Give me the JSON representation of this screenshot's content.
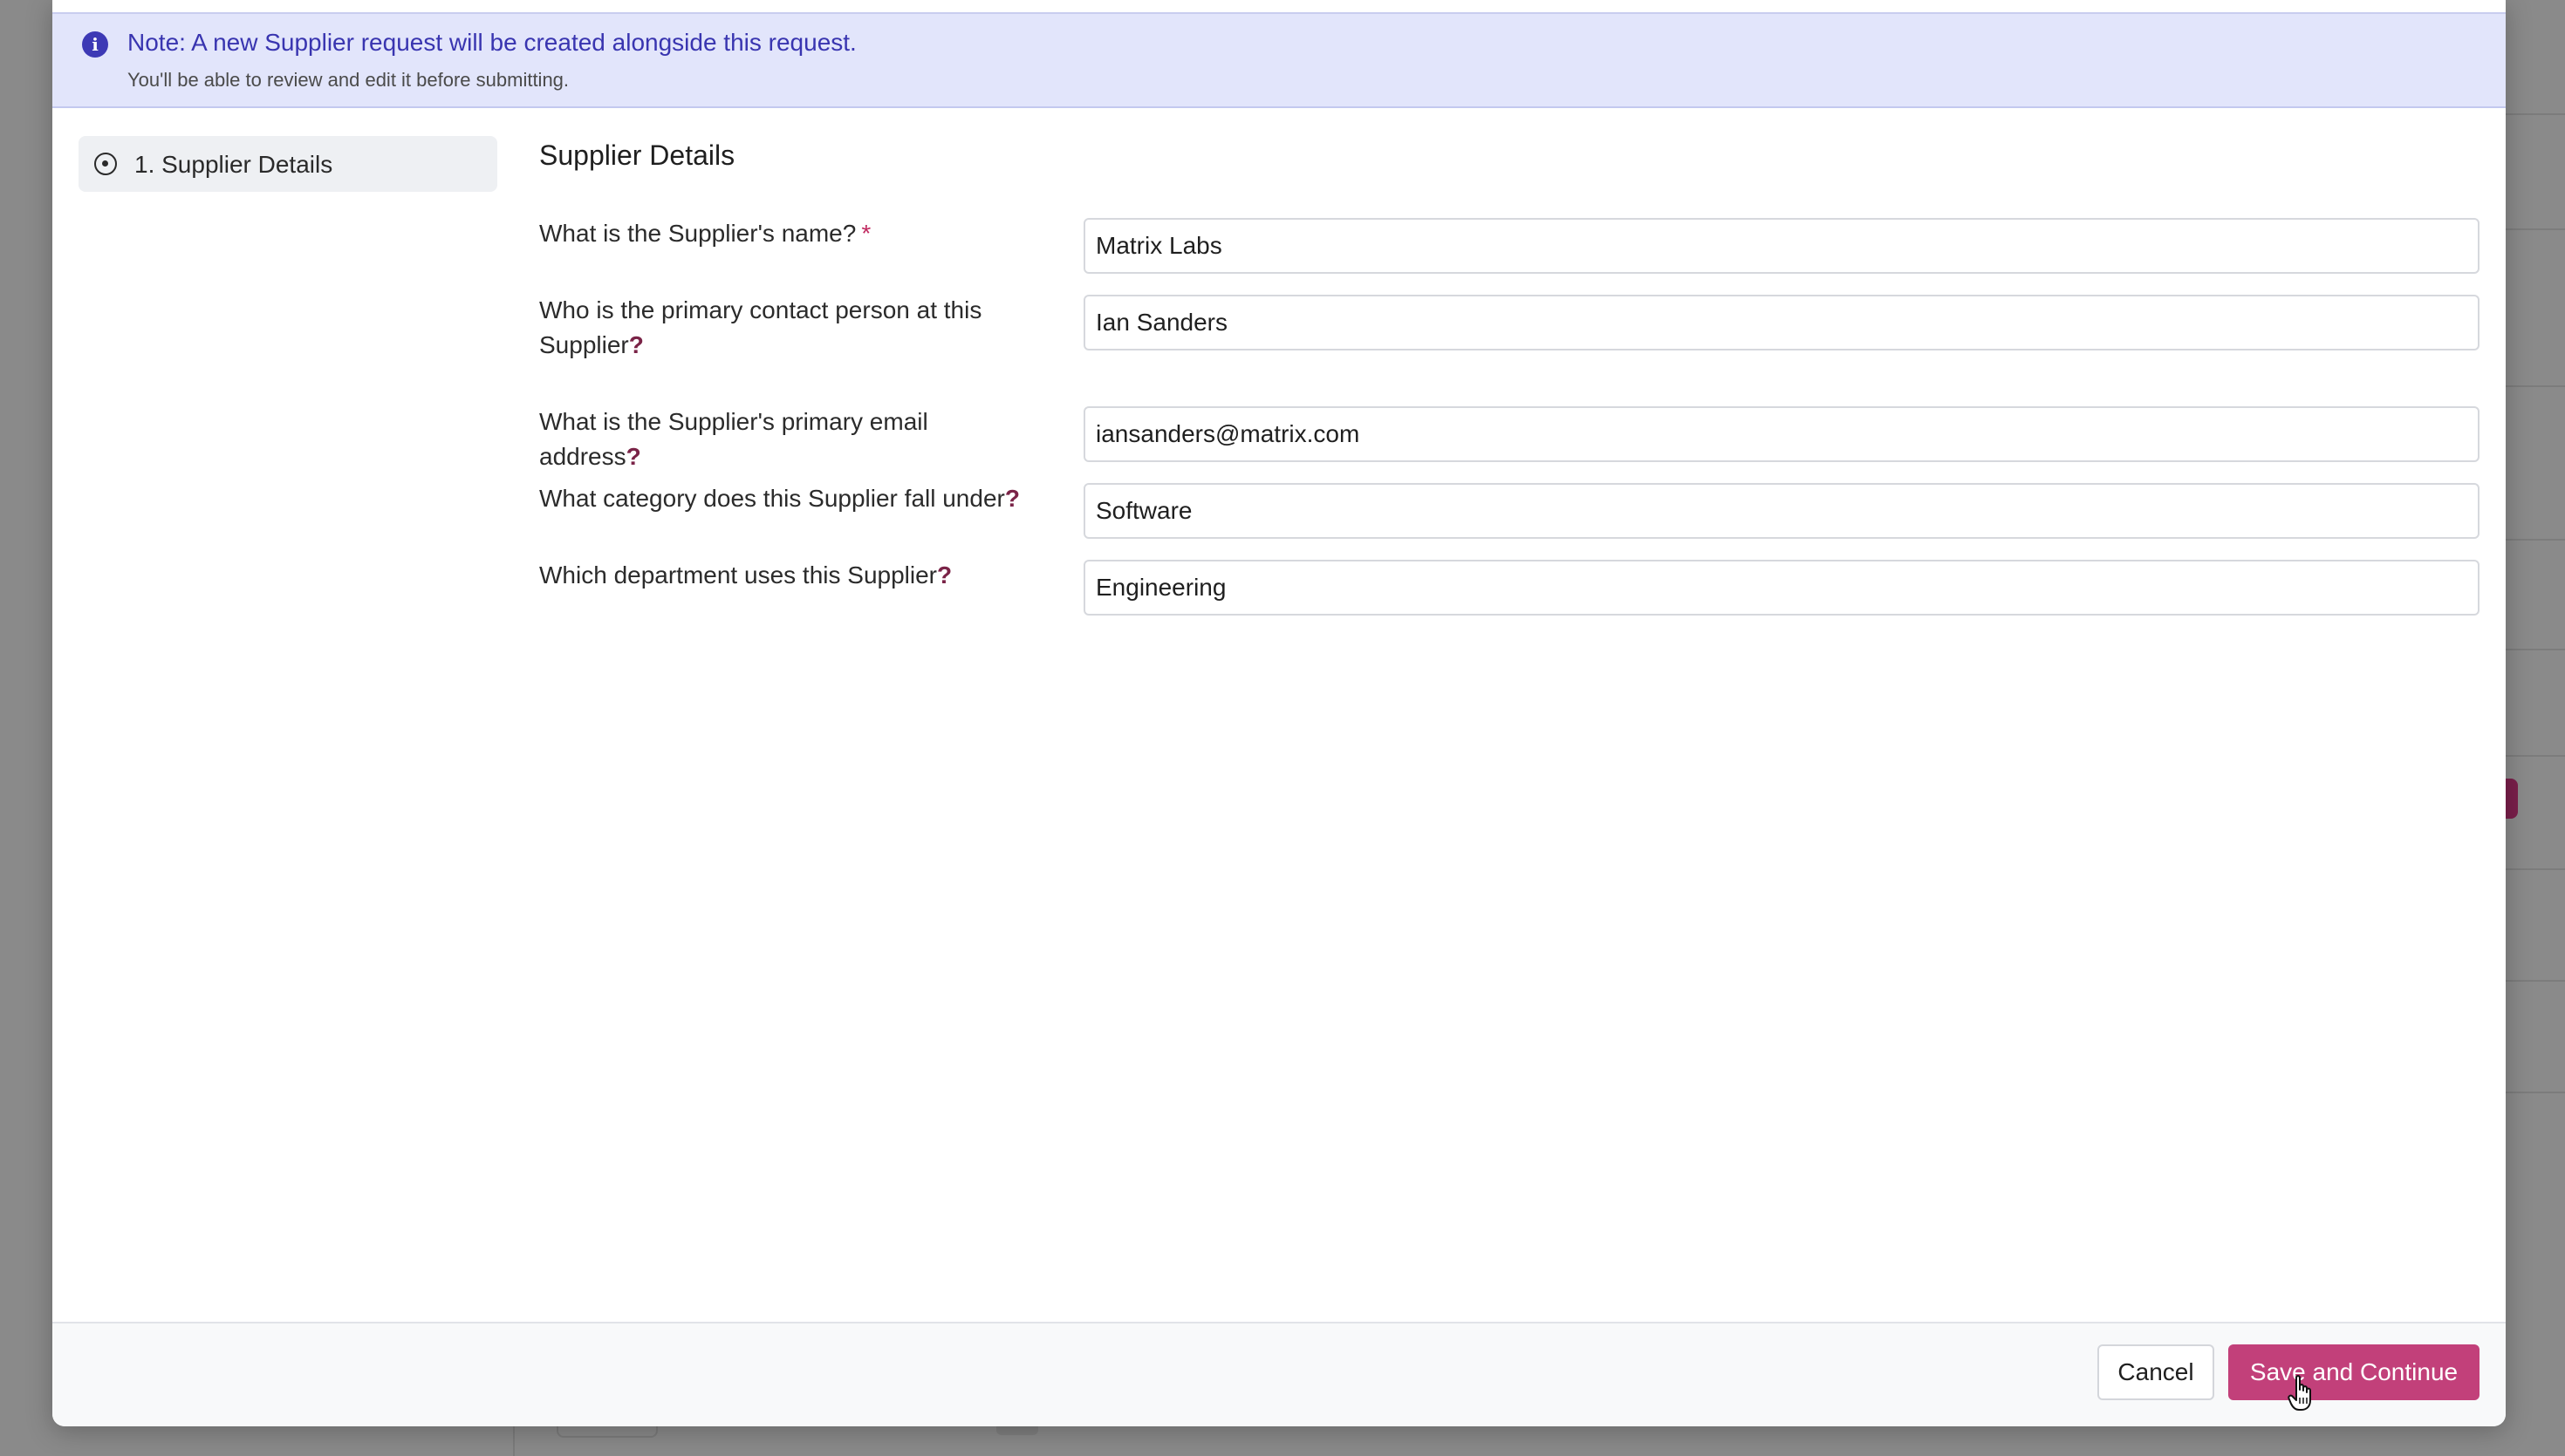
{
  "note": {
    "title": "Note: A new Supplier request will be created alongside this request.",
    "subtitle": "You'll be able to review and edit it before submitting.",
    "icon": "info-icon"
  },
  "steps": [
    {
      "label": "1. Supplier Details",
      "icon": "step-circle-icon",
      "active": true
    }
  ],
  "section": {
    "title": "Supplier Details"
  },
  "fields": [
    {
      "label": "What is the Supplier's name?",
      "marker": "*",
      "value": "Matrix Labs"
    },
    {
      "label": "Who is the primary contact person at this Supplier",
      "marker": "?",
      "value": "Ian Sanders"
    },
    {
      "label": "What is the Supplier's primary email address",
      "marker": "?",
      "value": "iansanders@matrix.com"
    },
    {
      "label": "What category does this Supplier fall under",
      "marker": "?",
      "value": "Software"
    },
    {
      "label": "Which department uses this Supplier",
      "marker": "?",
      "value": "Engineering"
    }
  ],
  "footer": {
    "cancel_label": "Cancel",
    "save_label": "Save and Continue"
  },
  "colors": {
    "accent": "#c2407a",
    "note_background": "#e2e5fb",
    "note_text": "#3935b0",
    "required_marker": "#c0285f"
  }
}
